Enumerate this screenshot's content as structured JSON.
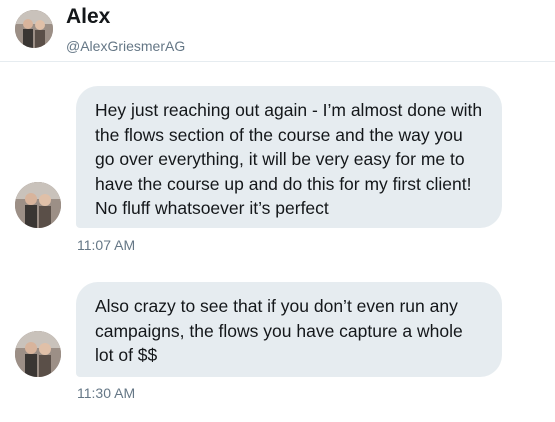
{
  "header": {
    "name": "Alex",
    "handle": "@AlexGriesmerAG"
  },
  "messages": [
    {
      "text": "Hey just reaching out again - I’m almost done with the flows section of the course and the way you go over everything, it will be very easy for me to have the course up and do this for my first client! No fluff whatsoever it’s perfect",
      "time": "11:07 AM"
    },
    {
      "text": "Also crazy to see that if you don’t even run any campaigns, the flows you have capture a whole lot of $$",
      "time": "11:30 AM"
    }
  ],
  "colors": {
    "bubble": "#e6ecf0",
    "meta_text": "#657786",
    "primary_text": "#14171a"
  }
}
